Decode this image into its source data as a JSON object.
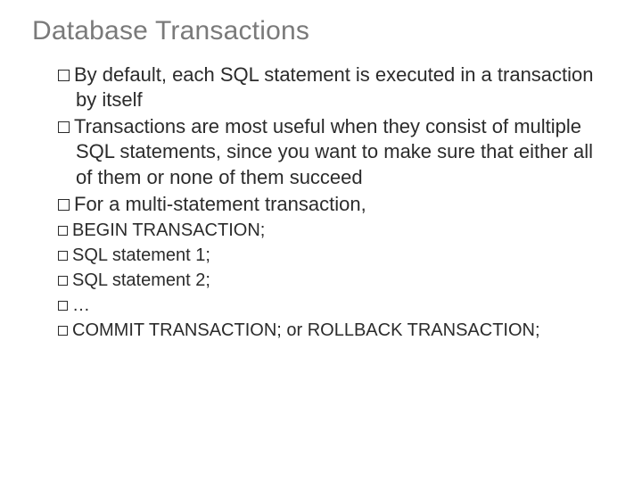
{
  "title": "Database Transactions",
  "bullets": {
    "b1": "By default, each SQL statement is executed in a transaction by itself",
    "b2": "Transactions are most useful when they consist of multiple SQL statements, since you want to make sure that either all of them or none of them succeed",
    "b3": "For a multi-statement transaction,",
    "sub": {
      "s1": "BEGIN  TRANSACTION;",
      "s2": "SQL statement 1;",
      "s3": "SQL statement 2;",
      "s4": "…",
      "s5": "COMMIT  TRANSACTION;  or ROLLBACK TRANSACTION;"
    }
  }
}
